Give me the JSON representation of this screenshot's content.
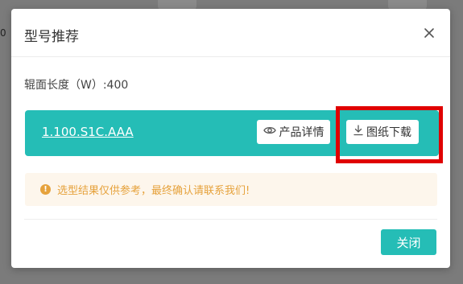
{
  "backdrop": {
    "left_text": "0"
  },
  "modal": {
    "title": "型号推荐",
    "field_label": "辊面长度（W）:400",
    "result": {
      "model_code": "1.100.S1C.AAA",
      "detail_button_label": "产品详情",
      "download_button_label": "图纸下载"
    },
    "notice_text": "选型结果仅供参考，最终确认请联系我们!",
    "close_button_label": "关闭"
  },
  "colors": {
    "accent": "#25bdb6",
    "warning": "#e6a23c",
    "highlight": "#e00000"
  },
  "icons": {
    "close": "close-icon",
    "eye": "eye-icon",
    "download": "download-icon",
    "warning": "warning-icon"
  }
}
